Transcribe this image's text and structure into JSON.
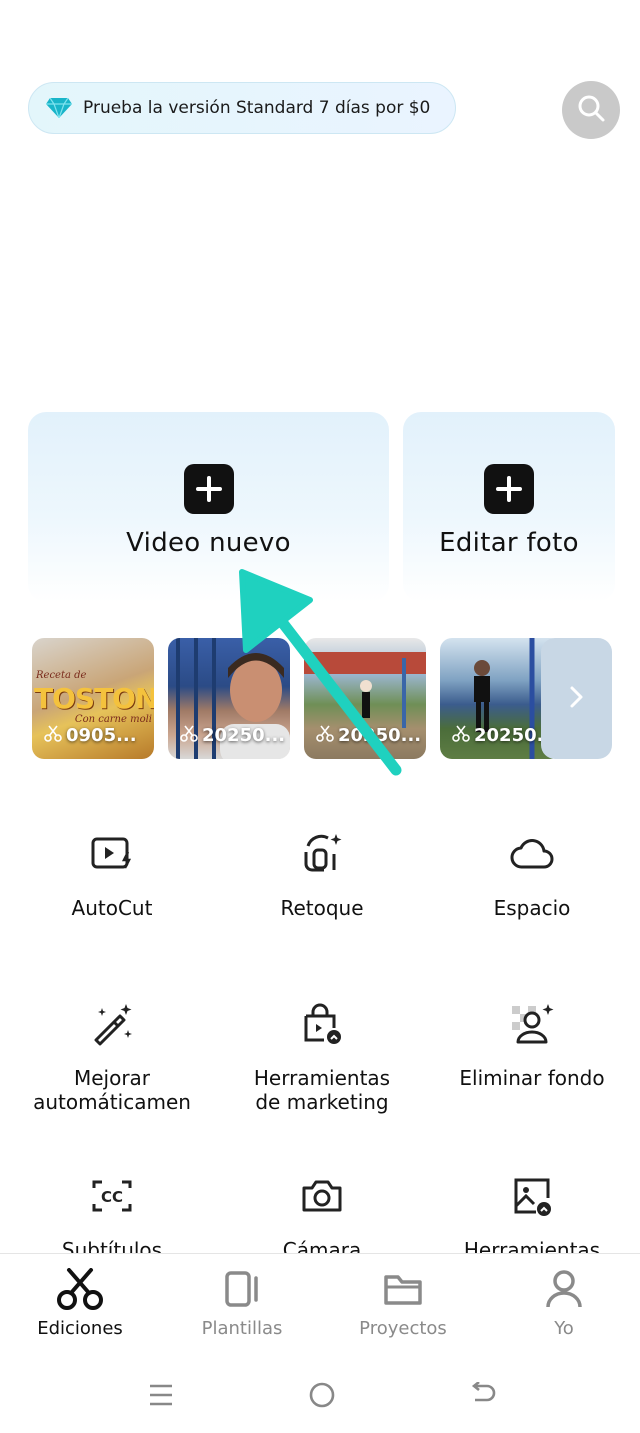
{
  "promo": {
    "text": "Prueba la versión Standard 7 días por $0",
    "icon": "diamond-icon",
    "accent": "#1fb6c9"
  },
  "search": {
    "icon": "search-icon"
  },
  "cards": {
    "video_label": "Video nuevo",
    "foto_label": "Editar foto"
  },
  "recent": {
    "items": [
      {
        "caption": "0905...",
        "overlay_top": "Receta de",
        "overlay_main": "TOSTONES",
        "overlay_sub": "Con carne moli"
      },
      {
        "caption": "20250..."
      },
      {
        "caption": "20250..."
      },
      {
        "caption": "20250..."
      }
    ],
    "more_icon": "chevron-right-icon"
  },
  "tools": [
    {
      "label": "AutoCut",
      "icon": "autocut-icon"
    },
    {
      "label": "Retoque",
      "icon": "retouch-icon"
    },
    {
      "label": "Espacio",
      "icon": "cloud-icon"
    },
    {
      "label": "Mejorar\nautomáticamen",
      "icon": "magic-wand-icon"
    },
    {
      "label": "Herramientas\nde marketing",
      "icon": "marketing-bag-icon"
    },
    {
      "label": "Eliminar fondo",
      "icon": "remove-background-icon"
    },
    {
      "label": "Subtítulos",
      "icon": "captions-icon"
    },
    {
      "label": "Cámara",
      "icon": "camera-icon"
    },
    {
      "label": "Herramientas",
      "icon": "image-tools-icon"
    }
  ],
  "nav": [
    {
      "label": "Ediciones",
      "icon": "scissors-icon",
      "active": true
    },
    {
      "label": "Plantillas",
      "icon": "templates-icon",
      "active": false
    },
    {
      "label": "Proyectos",
      "icon": "folder-icon",
      "active": false
    },
    {
      "label": "Yo",
      "icon": "profile-icon",
      "active": false
    }
  ],
  "annotation": {
    "color": "#1fd1bf"
  }
}
